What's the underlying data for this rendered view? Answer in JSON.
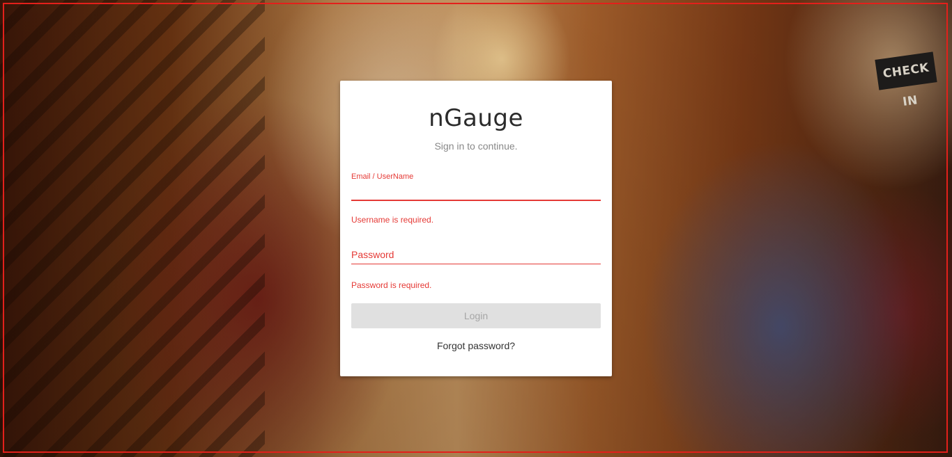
{
  "app": {
    "title": "nGauge",
    "subtitle": "Sign in to continue."
  },
  "background": {
    "sign_text": "CHECK IN"
  },
  "login_form": {
    "email": {
      "label": "Email / UserName",
      "value": "",
      "error": "Username is required."
    },
    "password": {
      "label": "Password",
      "value": "",
      "error": "Password is required."
    },
    "login_button_label": "Login",
    "forgot_password_label": "Forgot password?"
  },
  "colors": {
    "error": "#e53935",
    "frame_border": "#e3201b",
    "button_disabled_bg": "#e0e0e0",
    "button_disabled_text": "#a6a6a6"
  }
}
